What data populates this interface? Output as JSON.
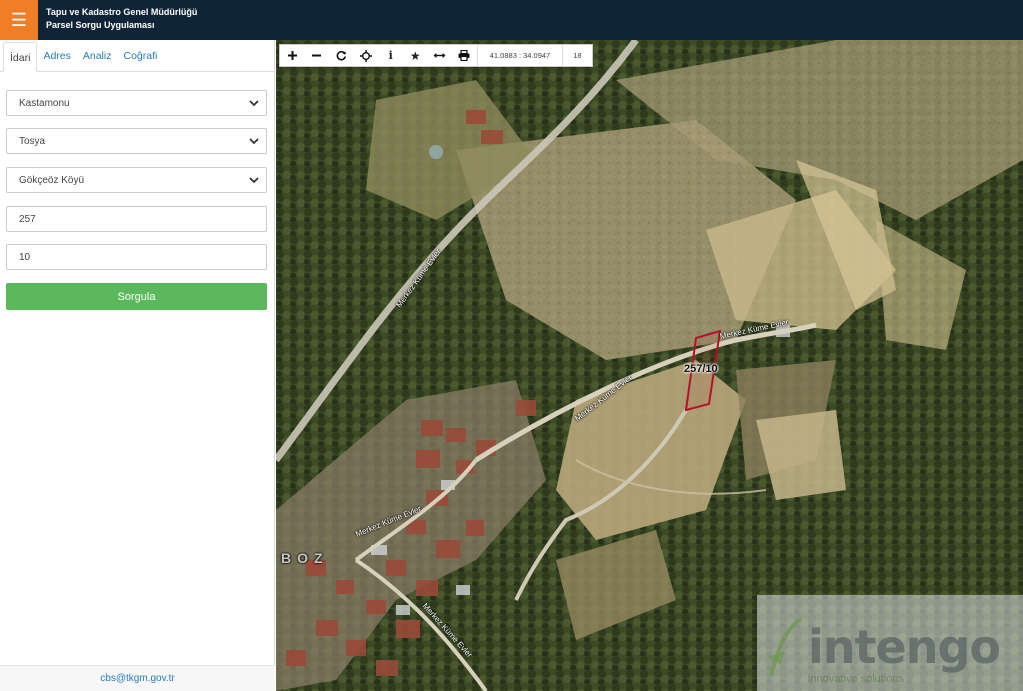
{
  "header": {
    "menu_icon": "hamburger-icon",
    "title_line1": "Tapu ve Kadastro Genel Müdürlüğü",
    "title_line2": "Parsel Sorgu Uygulaması"
  },
  "sidebar": {
    "tabs": [
      {
        "label": "İdari",
        "active": true
      },
      {
        "label": "Adres",
        "active": false
      },
      {
        "label": "Analiz",
        "active": false
      },
      {
        "label": "Coğrafi",
        "active": false
      }
    ],
    "province": "Kastamonu",
    "district": "Tosya",
    "village": "Gökçeöz Köyü",
    "block": "257",
    "parcel": "10",
    "query_button": "Sorgula",
    "footer_email": "cbs@tkgm.gov.tr"
  },
  "map": {
    "toolbar": {
      "icons": [
        "plus-icon",
        "minus-icon",
        "refresh-icon",
        "locate-icon",
        "info-icon",
        "star-icon",
        "measure-icon",
        "print-icon"
      ],
      "coordinates": "41.0883 : 34.0947",
      "zoom": "18"
    },
    "road_labels": [
      "Merkez Küme Evler",
      "Merkez Küme Evler",
      "Merkez Küme Evler",
      "Merkez Küme Evler",
      "Merkez Küme Evler"
    ],
    "place_label": "BOZ",
    "parcel_label": "257/10",
    "parcel_color": "#b0142a",
    "watermark_text": "intengo",
    "watermark_sub": "innovative solutions"
  },
  "colors": {
    "header_bg": "#0f2437",
    "menu_accent": "#f07e26",
    "query_button": "#5cb85c",
    "link": "#2a7ab0"
  }
}
